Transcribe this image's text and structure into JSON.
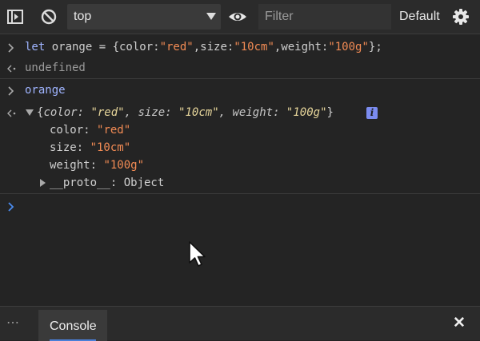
{
  "toolbar": {
    "context": "top",
    "filter_placeholder": "Filter",
    "log_level": "Default"
  },
  "console": {
    "entries": [
      {
        "type": "input",
        "text_parts": [
          "let orange = {color:",
          "\"red\"",
          ",size:",
          "\"10cm\"",
          ",weight:",
          "\"100g\"",
          "};"
        ]
      },
      {
        "type": "result",
        "text": "undefined"
      },
      {
        "type": "input",
        "text": "orange"
      },
      {
        "type": "result-object",
        "summary_parts": [
          "{",
          "color",
          ": ",
          "\"red\"",
          ", ",
          "size",
          ": ",
          "\"10cm\"",
          ", ",
          "weight",
          ": ",
          "\"100g\"",
          "}"
        ],
        "properties": [
          {
            "key": "color",
            "value": "\"red\""
          },
          {
            "key": "size",
            "value": "\"10cm\""
          },
          {
            "key": "weight",
            "value": "\"100g\""
          }
        ],
        "proto": {
          "key": "__proto__",
          "value": "Object"
        }
      }
    ]
  },
  "drawer": {
    "more_label": "⋯",
    "tab_label": "Console",
    "close_label": "✕"
  },
  "colors": {
    "background": "#242424",
    "toolbar": "#2b2b2b",
    "string": "#f28b54",
    "keyword": "#9fb4ff",
    "prompt_active": "#4a8cf0",
    "info_badge": "#7b8cf0"
  }
}
